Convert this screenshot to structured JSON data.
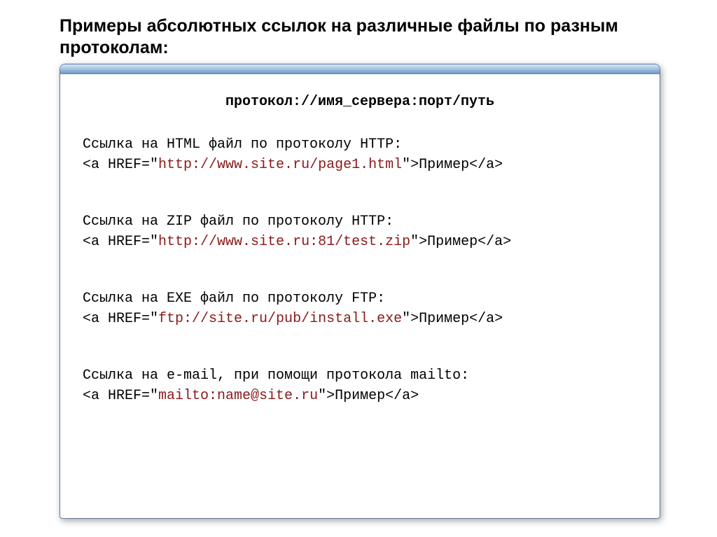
{
  "title": "Примеры абсолютных ссылок на различные файлы по разным протоколам:",
  "url_template": "протокол://имя_сервера:порт/путь",
  "examples": [
    {
      "desc": "Ссылка на HTML файл по протоколу HTTP:",
      "tag_open": "<a HREF=\"",
      "url": "http://www.site.ru/page1.html",
      "tag_close": "\">Пример</a>"
    },
    {
      "desc": "Ссылка на ZIP файл по протоколу HTTP:",
      "tag_open": "<a HREF=\"",
      "url": "http://www.site.ru:81/test.zip",
      "tag_close": "\">Пример</a>"
    },
    {
      "desc": "Ссылка на EXE файл по протоколу FTP:",
      "tag_open": "<a HREF=\"",
      "url": "ftp://site.ru/pub/install.exe",
      "tag_close": "\">Пример</a>"
    },
    {
      "desc": "Ссылка на e-mail, при помощи протокола mailto:",
      "tag_open": "<a HREF=\"",
      "url": "mailto:name@site.ru",
      "tag_close": "\">Пример</a>"
    }
  ]
}
